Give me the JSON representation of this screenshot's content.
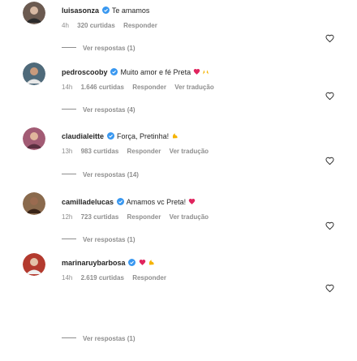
{
  "comments": [
    {
      "username": "luisasonza",
      "text": " Te amamos",
      "emojis": [],
      "time": "4h",
      "likes": "320 curtidas",
      "reply_label": "Responder",
      "translate_label": "",
      "view_replies": "Ver respostas (1)",
      "avatar_color": "#6b5a50"
    },
    {
      "username": "pedroscooby",
      "text": " Muito amor e fé Preta",
      "emojis": [
        "heart-emoji",
        "raised-hands-emoji"
      ],
      "time": "14h",
      "likes": "1.646 curtidas",
      "reply_label": "Responder",
      "translate_label": "Ver tradução",
      "view_replies": "Ver respostas (4)",
      "avatar_color": "#4f6a7a"
    },
    {
      "username": "claudialeitte",
      "text": " Força, Pretinha!",
      "emojis": [
        "flexed-biceps-emoji"
      ],
      "time": "13h",
      "likes": "983 curtidas",
      "reply_label": "Responder",
      "translate_label": "Ver tradução",
      "view_replies": "Ver respostas (14)",
      "avatar_color": "#a25b74"
    },
    {
      "username": "camilladelucas",
      "text": " Amamos vc Preta!",
      "emojis": [
        "heart-emoji"
      ],
      "time": "12h",
      "likes": "723 curtidas",
      "reply_label": "Responder",
      "translate_label": "Ver tradução",
      "view_replies": "Ver respostas (1)",
      "avatar_color": "#8a6a4d"
    },
    {
      "username": "marinaruybarbosa",
      "text": " ",
      "emojis": [
        "heart-emoji",
        "flexed-biceps-emoji"
      ],
      "time": "14h",
      "likes": "2.619 curtidas",
      "reply_label": "Responder",
      "translate_label": "",
      "view_replies": "Ver respostas (1)",
      "avatar_color": "#b33a2e"
    }
  ],
  "colors": {
    "username": "#262626",
    "meta": "#8e8e8e",
    "verified": "#3897f0",
    "heart_emoji": "#e0245e",
    "biceps_emoji": "#f5b301"
  },
  "icons": {
    "like": "heart-outline-icon",
    "verified": "verified-badge-icon"
  }
}
